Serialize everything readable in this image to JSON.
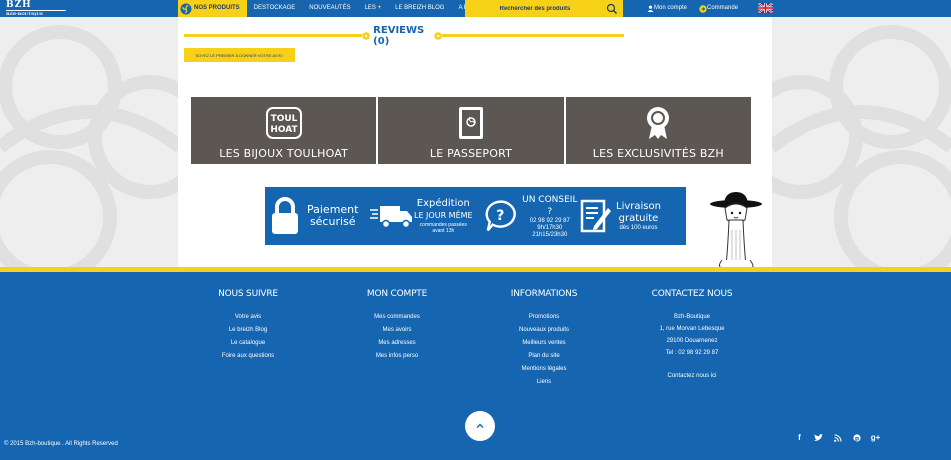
{
  "logo": {
    "text": "BZH",
    "subtext": "BZH-BOUTIQUE"
  },
  "nav": {
    "items": [
      "Nos produits",
      "Destockage",
      "Nouveautés",
      "Les +",
      "Le breizh blog",
      "A propos"
    ]
  },
  "search": {
    "placeholder": "Rechercher des produits"
  },
  "account": {
    "my_account": "Mon compte",
    "order": "Commande"
  },
  "reviews": {
    "title": "REVIEWS (0)",
    "first_review_button": "SOYEZ LE PREMIER À DONNER VOTRE AVIS !"
  },
  "tiles": [
    {
      "label": "LES BIJOUX TOULHOAT",
      "icon": "toulhoat-logo-icon",
      "icon_text": "TOUL HOAT"
    },
    {
      "label": "LE PASSEPORT",
      "icon": "passport-icon"
    },
    {
      "label": "LES EXCLUSIVITÉS BZH",
      "icon": "award-ribbon-icon"
    }
  ],
  "banner": {
    "payment": {
      "line1": "Paiement",
      "line2": "sécurisé"
    },
    "shipping": {
      "line1": "Expédition",
      "line2": "le jour même",
      "note1": "commandes passées",
      "note2": "avant 13h"
    },
    "advice": {
      "title": "UN CONSEIL ?",
      "phone": "02 98 92 29 87",
      "hours1": "9h/17h30",
      "hours2": "21h15/23h30"
    },
    "delivery": {
      "line1": "Livraison",
      "line2": "gratuite",
      "note": "dès 100 euros"
    }
  },
  "footer": {
    "follow": {
      "title": "NOUS SUIVRE",
      "links": [
        "Votre avis",
        "Le breizh Blog",
        "Le catalogue",
        "Foire aux questions"
      ]
    },
    "account": {
      "title": "MON COMPTE",
      "links": [
        "Mes commandes",
        "Mes avoirs",
        "Mes adresses",
        "Mes infos perso"
      ]
    },
    "info": {
      "title": "INFORMATIONS",
      "links": [
        "Promotions",
        "Nouveaux produits",
        "Meilleurs ventes",
        "Plan du site",
        "Mentions légales",
        "Liens"
      ]
    },
    "contact": {
      "title": "CONTACTEZ NOUS",
      "lines": [
        "Bzh-Boutique",
        "1, rue Morvan Lebesque",
        "29100 Douarnenez",
        "Tel : 02 98 92 29 87"
      ],
      "link": "Contactez nous ici"
    },
    "copyright": "© 2015 Bzh-boutique . All Rights Reserved"
  },
  "social": [
    "facebook-icon",
    "twitter-icon",
    "rss-icon",
    "pinterest-icon",
    "google-plus-icon"
  ],
  "colors": {
    "brand_blue": "#1565b0",
    "brand_yellow": "#f7d117",
    "tile_gray": "#5d5754",
    "dark_blue": "#1b3d6e"
  }
}
